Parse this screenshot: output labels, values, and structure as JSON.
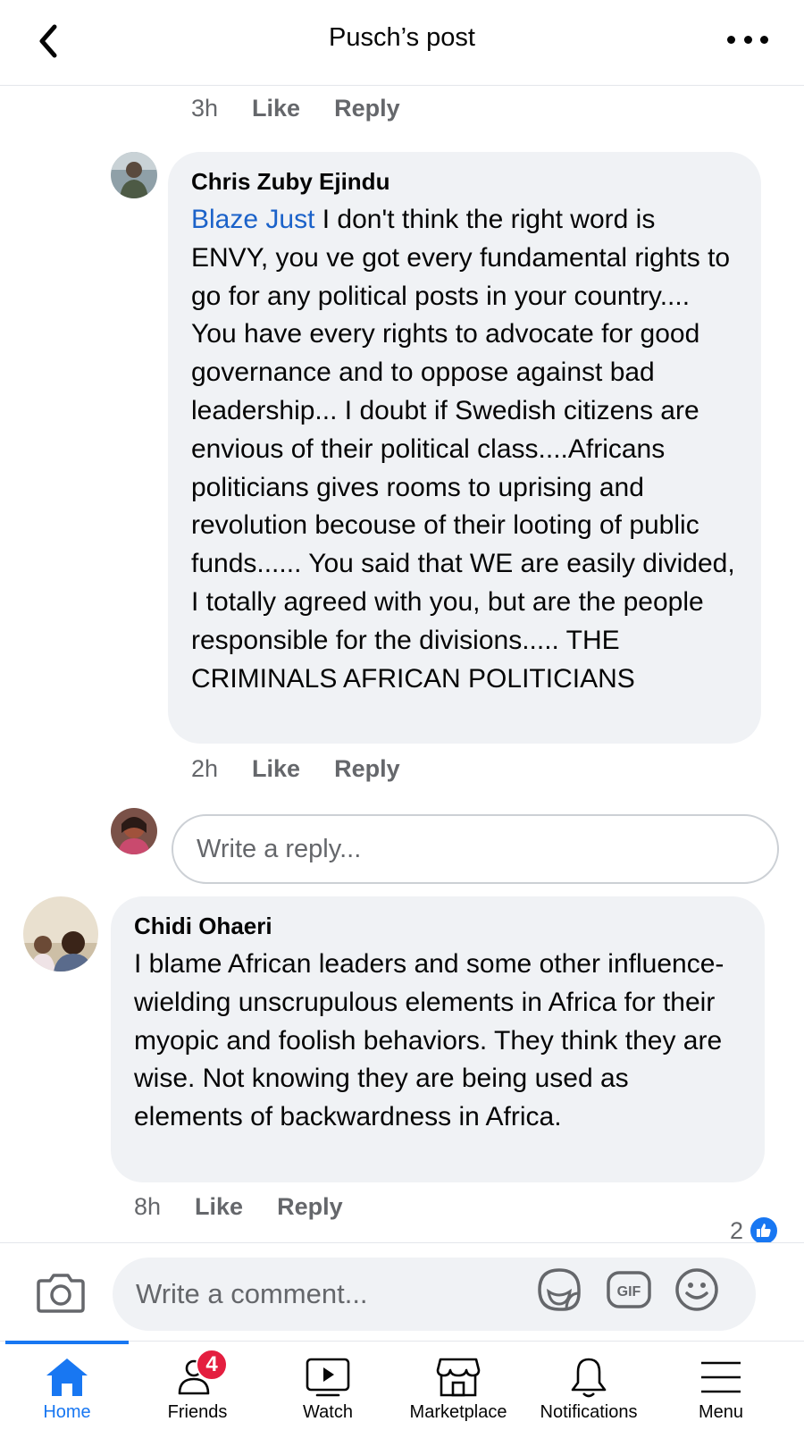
{
  "header": {
    "title": "Pusch’s post"
  },
  "prev_comment_meta": {
    "time": "3h",
    "like": "Like",
    "reply": "Reply"
  },
  "comments": [
    {
      "author": "Chris Zuby Ejindu",
      "mention": "Blaze Just",
      "text": " I don't think the right word is ENVY, you ve got every fundamental rights to go for any political posts in your country.... You have every rights to advocate for good governance and to oppose against bad leadership... I doubt if Swedish citizens are envious of their political class....Africans politicians gives rooms to uprising and revolution becouse of their looting of public funds...... You said that WE are easily divided, I totally agreed with you, but are the people responsible for the divisions..... THE CRIMINALS AFRICAN POLITICIANS",
      "time": "2h",
      "like": "Like",
      "reply": "Reply"
    },
    {
      "author": "Chidi Ohaeri",
      "text": "I blame African leaders and some other influence-wielding unscrupulous elements in Africa for their myopic and foolish behaviors. They think they are wise. Not knowing they are being used as elements of backwardness in Africa.",
      "time": "8h",
      "like": "Like",
      "reply": "Reply",
      "reaction_count": "2"
    }
  ],
  "reply_box": {
    "placeholder": "Write a reply..."
  },
  "composer": {
    "placeholder": "Write a comment..."
  },
  "nav": {
    "items": [
      {
        "label": "Home",
        "icon": "home-icon"
      },
      {
        "label": "Friends",
        "icon": "friends-icon",
        "badge": "4"
      },
      {
        "label": "Watch",
        "icon": "watch-icon"
      },
      {
        "label": "Marketplace",
        "icon": "marketplace-icon"
      },
      {
        "label": "Notifications",
        "icon": "bell-icon"
      },
      {
        "label": "Menu",
        "icon": "menu-icon"
      }
    ]
  },
  "colors": {
    "accent": "#1877f2",
    "mention": "#1b62c9",
    "bubble": "#f0f2f5",
    "badge": "#e41e3f",
    "secondary_text": "#65676b"
  }
}
